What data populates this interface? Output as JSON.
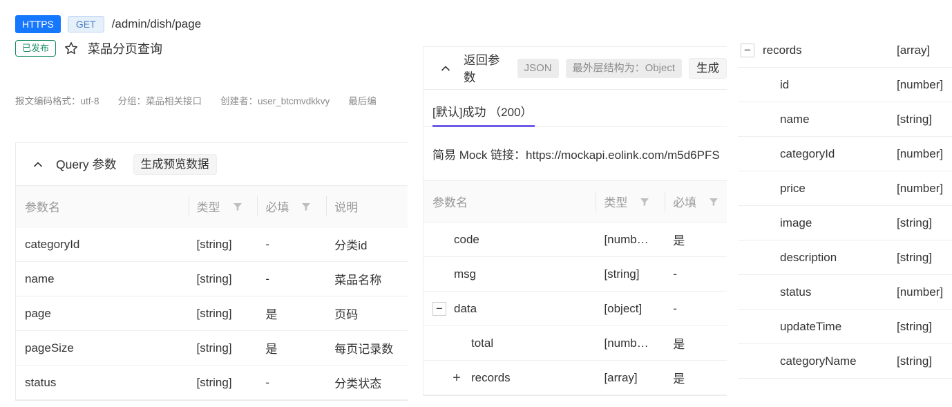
{
  "header": {
    "protocol": "HTTPS",
    "method": "GET",
    "path": "/admin/dish/page",
    "status": "已发布",
    "api_name": "菜品分页查询",
    "meta": [
      "报文编码格式：utf-8",
      "分组：菜品相关接口",
      "创建者：user_btcmvdkkvy",
      "最后编"
    ]
  },
  "query_panel": {
    "title": "Query 参数",
    "preview_button": "生成预览数据",
    "columns": [
      "参数名",
      "类型",
      "必填",
      "说明"
    ],
    "rows": [
      {
        "name": "categoryId",
        "type": "[string]",
        "required": "-",
        "desc": "分类id"
      },
      {
        "name": "name",
        "type": "[string]",
        "required": "-",
        "desc": "菜品名称"
      },
      {
        "name": "page",
        "type": "[string]",
        "required": "是",
        "desc": "页码"
      },
      {
        "name": "pageSize",
        "type": "[string]",
        "required": "是",
        "desc": "每页记录数"
      },
      {
        "name": "status",
        "type": "[string]",
        "required": "-",
        "desc": "分类状态"
      }
    ]
  },
  "response_panel": {
    "title": "返回参数",
    "format_tag": "JSON",
    "outer_tag": "最外层结构为：Object",
    "generate_button": "生成",
    "tab": "[默认]成功 （200）",
    "mock_link": "简易 Mock 链接：https://mockapi.eolink.com/m5d6PFS",
    "columns": [
      "参数名",
      "类型",
      "必填"
    ],
    "rows": [
      {
        "name": "code",
        "type": "[numb…",
        "required": "是",
        "toggle": ""
      },
      {
        "name": "msg",
        "type": "[string]",
        "required": "-",
        "toggle": ""
      },
      {
        "name": "data",
        "type": "[object]",
        "required": "-",
        "toggle": "−"
      },
      {
        "name": "total",
        "type": "[numb…",
        "required": "是",
        "toggle": ""
      },
      {
        "name": "records",
        "type": "[array]",
        "required": "是",
        "toggle": "+"
      }
    ]
  },
  "records_panel": {
    "parent": {
      "name": "records",
      "type": "[array]",
      "toggle": "−"
    },
    "children": [
      {
        "name": "id",
        "type": "[number]"
      },
      {
        "name": "name",
        "type": "[string]"
      },
      {
        "name": "categoryId",
        "type": "[number]"
      },
      {
        "name": "price",
        "type": "[number]"
      },
      {
        "name": "image",
        "type": "[string]"
      },
      {
        "name": "description",
        "type": "[string]"
      },
      {
        "name": "status",
        "type": "[number]"
      },
      {
        "name": "updateTime",
        "type": "[string]"
      },
      {
        "name": "categoryName",
        "type": "[string]"
      }
    ]
  },
  "colors": {
    "https_tag": "#1677ff",
    "published": "#1a8c66",
    "tab_underline": "#6d5ce7"
  }
}
